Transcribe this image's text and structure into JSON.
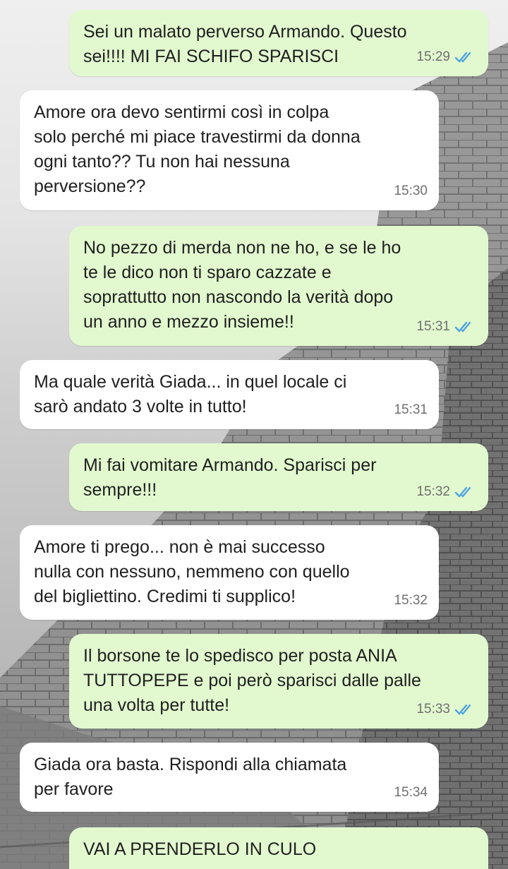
{
  "messages": [
    {
      "dir": "out",
      "text": "Sei un malato perverso Armando. Questo\nsei!!!! MI FAI SCHIFO SPARISCI",
      "time": "15:29",
      "read": true
    },
    {
      "dir": "in",
      "text": "Amore ora devo sentirmi così in colpa\nsolo perché mi piace travestirmi da donna\nogni tanto?? Tu non hai nessuna\nperversione??",
      "time": "15:30"
    },
    {
      "dir": "out",
      "text": "No pezzo di merda non ne ho, e se le ho\nte le dico non ti sparo cazzate e\nsoprattutto non nascondo la verità dopo\nun anno e mezzo insieme!!",
      "time": "15:31",
      "read": true
    },
    {
      "dir": "in",
      "text": "Ma quale verità Giada... in quel locale ci\nsarò andato 3 volte in tutto!",
      "time": "15:31"
    },
    {
      "dir": "out",
      "text": "Mi fai vomitare Armando. Sparisci per\nsempre!!!",
      "time": "15:32",
      "read": true
    },
    {
      "dir": "in",
      "text": "Amore ti prego... non è mai successo\nnulla con nessuno, nemmeno con quello\ndel bigliettino. Credimi ti supplico!",
      "time": "15:32"
    },
    {
      "dir": "out",
      "text": "Il borsone te lo spedisco per posta ANIA\nTUTTOPEPE e poi però sparisci dalle palle\nuna volta per tutte!",
      "time": "15:33",
      "read": true
    },
    {
      "dir": "in",
      "text": "Giada ora basta. Rispondi alla chiamata\nper favore",
      "time": "15:34"
    },
    {
      "dir": "out",
      "text": "VAI A PRENDERLO IN CULO",
      "time": "",
      "read": false
    }
  ],
  "colors": {
    "outgoing_bubble": "#e2f9cf",
    "incoming_bubble": "#ffffff",
    "read_ticks": "#4fa3e0",
    "timestamp": "#6f6f6f"
  },
  "icons": {
    "read_receipt": "double-check-icon"
  }
}
